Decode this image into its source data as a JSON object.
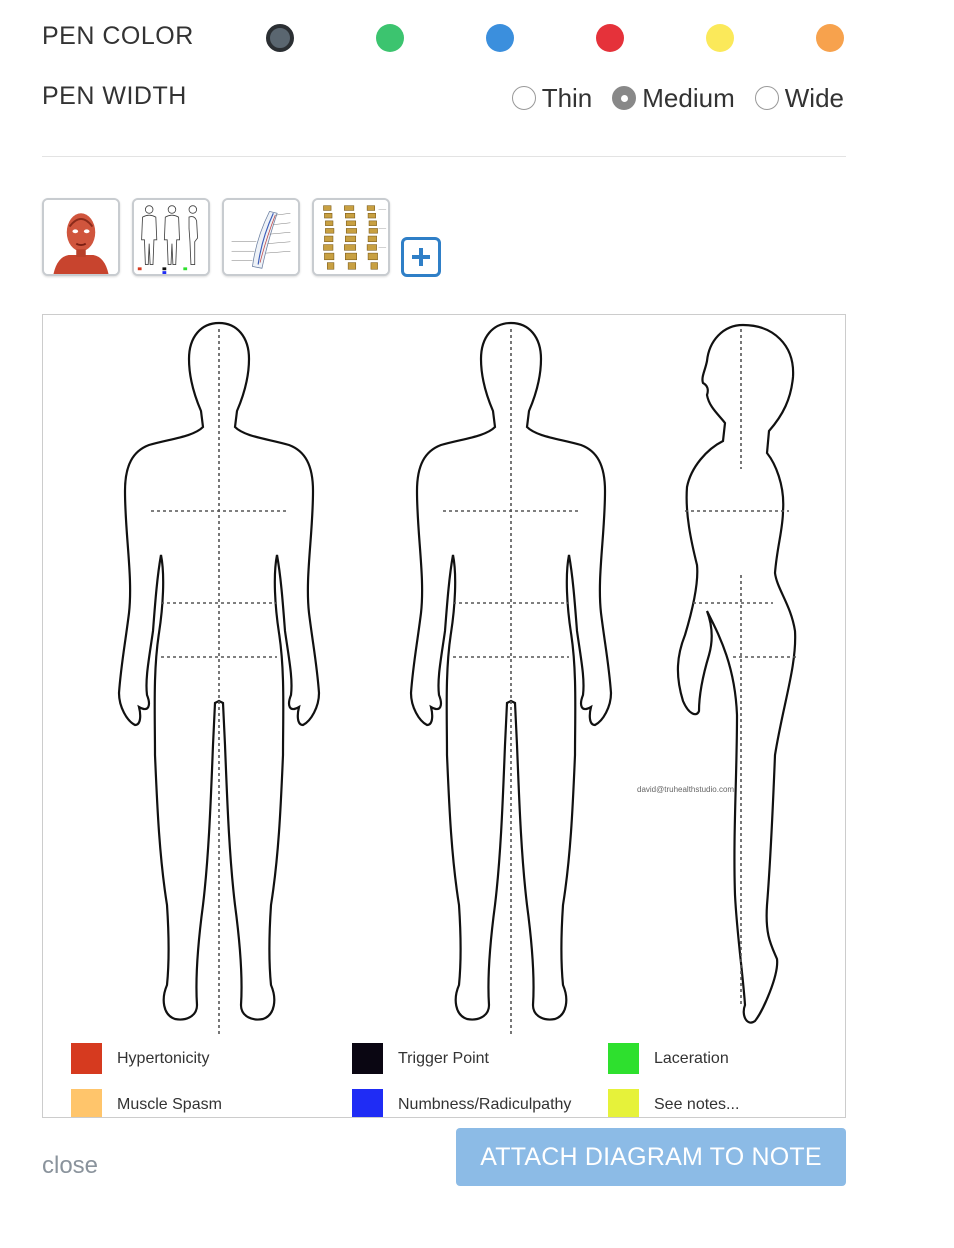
{
  "pen_color": {
    "label": "PEN COLOR",
    "swatches": [
      {
        "name": "dark-gray",
        "color": "#5a6670",
        "selected": true
      },
      {
        "name": "green",
        "color": "#3cc46f"
      },
      {
        "name": "blue",
        "color": "#3b8fdd"
      },
      {
        "name": "red",
        "color": "#e5323a"
      },
      {
        "name": "yellow",
        "color": "#fbe95a"
      },
      {
        "name": "orange",
        "color": "#f7a24d"
      }
    ]
  },
  "pen_width": {
    "label": "PEN WIDTH",
    "options": [
      {
        "label": "Thin",
        "checked": false
      },
      {
        "label": "Medium",
        "checked": true
      },
      {
        "label": "Wide",
        "checked": false
      }
    ]
  },
  "thumbnails": [
    {
      "name": "head-muscles-thumbnail"
    },
    {
      "name": "body-outline-thumbnail"
    },
    {
      "name": "arm-nerves-thumbnail"
    },
    {
      "name": "spine-thumbnail"
    }
  ],
  "add_diagram_icon": "plus-square-icon",
  "diagram": {
    "watermark": "david@truhealthstudio.com",
    "legend": [
      {
        "label": "Hypertonicity",
        "color": "#d63a1f"
      },
      {
        "label": "Trigger Point",
        "color": "#0a0612"
      },
      {
        "label": "Laceration",
        "color": "#2ee02e"
      },
      {
        "label": "Muscle Spasm",
        "color": "#ffc56b"
      },
      {
        "label": "Numbness/Radiculpathy",
        "color": "#1f2cf5"
      },
      {
        "label": "See notes...",
        "color": "#e6f23a"
      }
    ]
  },
  "footer": {
    "close_label": "close",
    "attach_label": "ATTACH DIAGRAM TO NOTE"
  }
}
